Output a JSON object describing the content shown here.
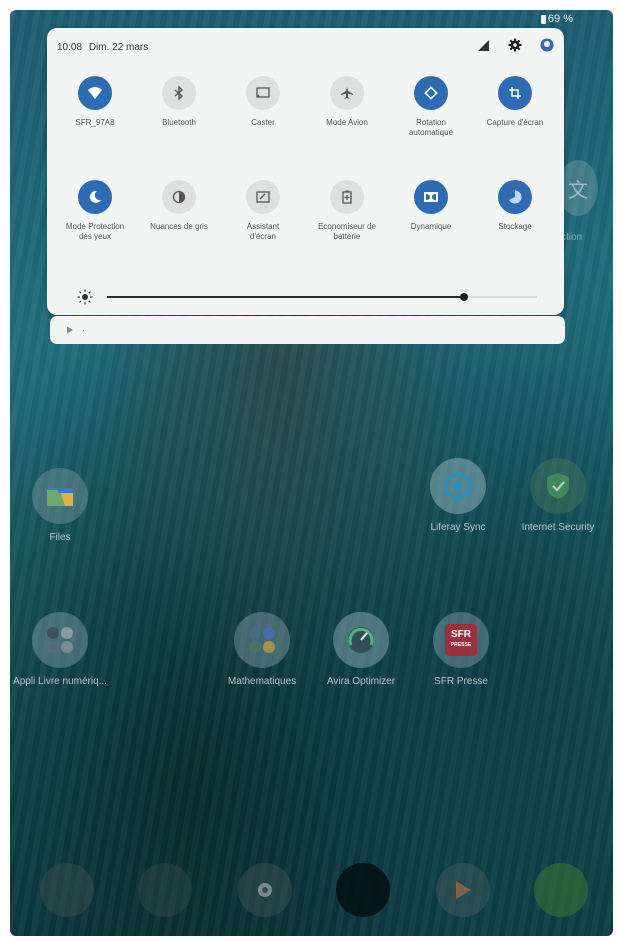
{
  "status_bar": {
    "battery": "69 %"
  },
  "quick_settings": {
    "time": "10:08",
    "date": "Dim. 22 mars",
    "tiles_row1": [
      {
        "label": "SFR_97A8",
        "icon": "wifi-icon",
        "active": true
      },
      {
        "label": "Bluetooth",
        "icon": "bluetooth-icon",
        "active": false
      },
      {
        "label": "Caster",
        "icon": "cast-icon",
        "active": false
      },
      {
        "label": "Mode Avion",
        "icon": "airplane-icon",
        "active": false
      },
      {
        "label": "Rotation\nautomatique",
        "icon": "rotation-icon",
        "active": true
      },
      {
        "label": "Capture d'écran",
        "icon": "crop-icon",
        "active": true
      }
    ],
    "tiles_row2": [
      {
        "label": "Mode Protection\ndes yeux",
        "icon": "moon-icon",
        "active": true
      },
      {
        "label": "Nuances de gris",
        "icon": "grayscale-icon",
        "active": false
      },
      {
        "label": "Assistant\nd'écran",
        "icon": "screen-assistant-icon",
        "active": false
      },
      {
        "label": "Economiseur de\nbatterie",
        "icon": "battery-saver-icon",
        "active": false
      },
      {
        "label": "Dynamique",
        "icon": "dolby-icon",
        "active": true
      },
      {
        "label": "Stockage",
        "icon": "storage-icon",
        "active": true
      }
    ],
    "brightness_level": 0.83
  },
  "notification": {
    "text": "·"
  },
  "home_apps": [
    {
      "label": "Files",
      "icon": "files-icon"
    },
    {
      "label": "Liferay Sync",
      "icon": "liferay-sync-icon"
    },
    {
      "label": "Internet Security",
      "icon": "shield-check-icon"
    },
    {
      "label": "Appli Livre numériq...",
      "icon": "folder-icon"
    },
    {
      "label": "Mathematiques",
      "icon": "folder-icon"
    },
    {
      "label": "Avira Optimizer",
      "icon": "speedometer-icon"
    },
    {
      "label": "SFR Presse",
      "icon": "sfr-presse-icon"
    }
  ],
  "partial_app": {
    "label": "ction",
    "icon": "translate-icon"
  },
  "sfr_logo": {
    "top": "SFR",
    "bottom": "PRESSE"
  }
}
